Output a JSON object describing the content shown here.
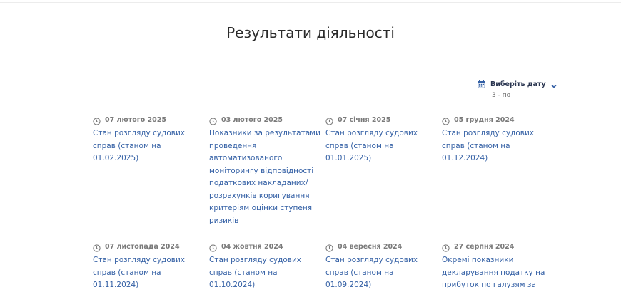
{
  "page": {
    "title": "Результати діяльності"
  },
  "filter": {
    "date_label": "Виберіть дату",
    "sort_label": "3 - по",
    "icon": "calendar-icon",
    "accent": "#3460a5"
  },
  "items": [
    {
      "date": "07 лютого 2025",
      "title": "Стан розгляду судових справ (станом на 01.02.2025)"
    },
    {
      "date": "03 лютого 2025",
      "title": "Показники за результатами проведення автоматизованого моніторингу відповідності податкових накладаних/ розрахунків коригування критеріям оцінки ступеня ризиків"
    },
    {
      "date": "07 січня 2025",
      "title": "Стан розгляду судових справ (станом на 01.01.2025)"
    },
    {
      "date": "05 грудня 2024",
      "title": "Стан розгляду судових справ (станом на 01.12.2024)"
    },
    {
      "date": "07 листопада 2024",
      "title": "Стан розгляду судових справ (станом на 01.11.2024)"
    },
    {
      "date": "04 жовтня 2024",
      "title": "Стан розгляду судових справ (станом на 01.10.2024)"
    },
    {
      "date": "04 вересня 2024",
      "title": "Стан розгляду судових справ (станом на 01.09.2024)"
    },
    {
      "date": "27 серпня 2024",
      "title": "Окремі показники декларування податку на прибуток по галузям за"
    }
  ]
}
